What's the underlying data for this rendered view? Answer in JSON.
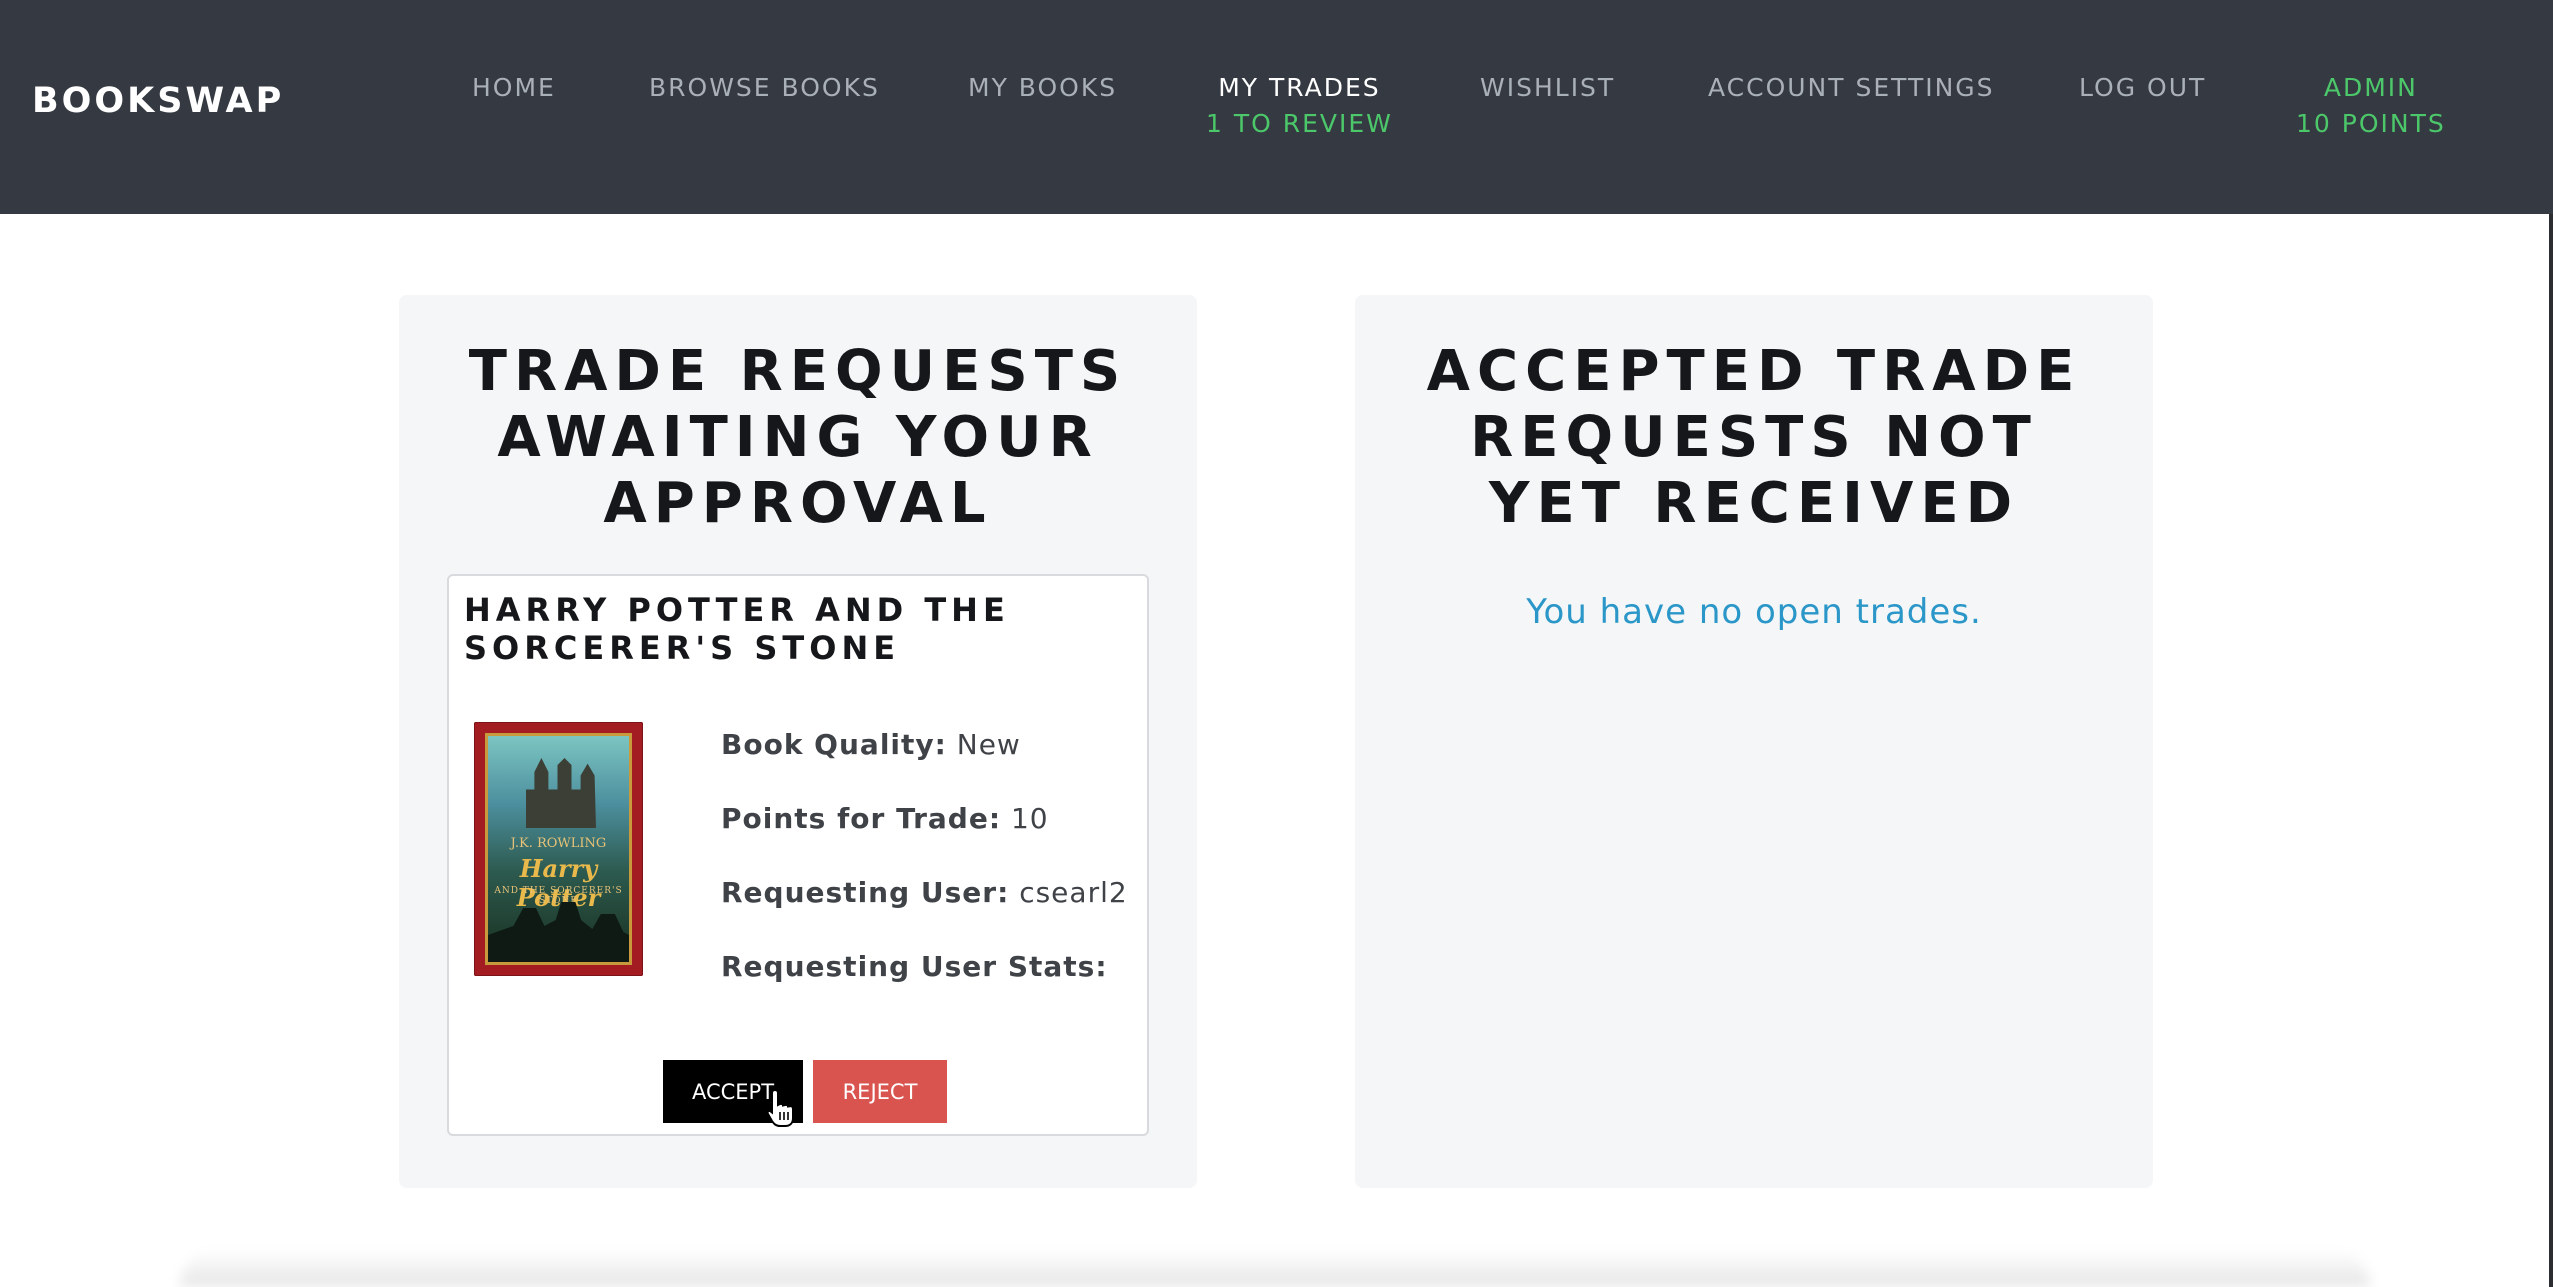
{
  "navbar": {
    "brand": "BOOKSWAP",
    "items": [
      {
        "label": "HOME"
      },
      {
        "label": "BROWSE BOOKS"
      },
      {
        "label": "MY BOOKS"
      },
      {
        "label": "MY TRADES",
        "sub": "1 TO REVIEW"
      },
      {
        "label": "WISHLIST"
      },
      {
        "label": "ACCOUNT SETTINGS"
      },
      {
        "label": "LOG OUT"
      },
      {
        "label": "ADMIN",
        "sub": "10 POINTS"
      }
    ],
    "active_item": "MY TRADES"
  },
  "pending": {
    "title": "TRADE REQUESTS AWAITING YOUR APPROVAL",
    "trade": {
      "book_title": "HARRY POTTER AND THE SORCERER'S STONE",
      "cover_author": "J.K. ROWLING",
      "cover_title": "Harry Potter",
      "cover_subtitle": "AND THE SORCERER'S STONE",
      "quality_label": "Book Quality:",
      "quality_value": "New",
      "points_label": "Points for Trade:",
      "points_value": "10",
      "user_label": "Requesting User:",
      "user_value": "csearl2",
      "stats_label": "Requesting User Stats:",
      "stats_value": "",
      "accept_label": "ACCEPT",
      "reject_label": "REJECT"
    }
  },
  "accepted": {
    "title": "ACCEPTED TRADE REQUESTS NOT YET RECEIVED",
    "empty_message": "You have no open trades."
  },
  "colors": {
    "navbar_bg": "#353a42",
    "accent_green": "#4cc86a",
    "link_blue": "#2a97c8",
    "reject_red": "#d9534f",
    "panel_bg": "#f5f6f8"
  }
}
